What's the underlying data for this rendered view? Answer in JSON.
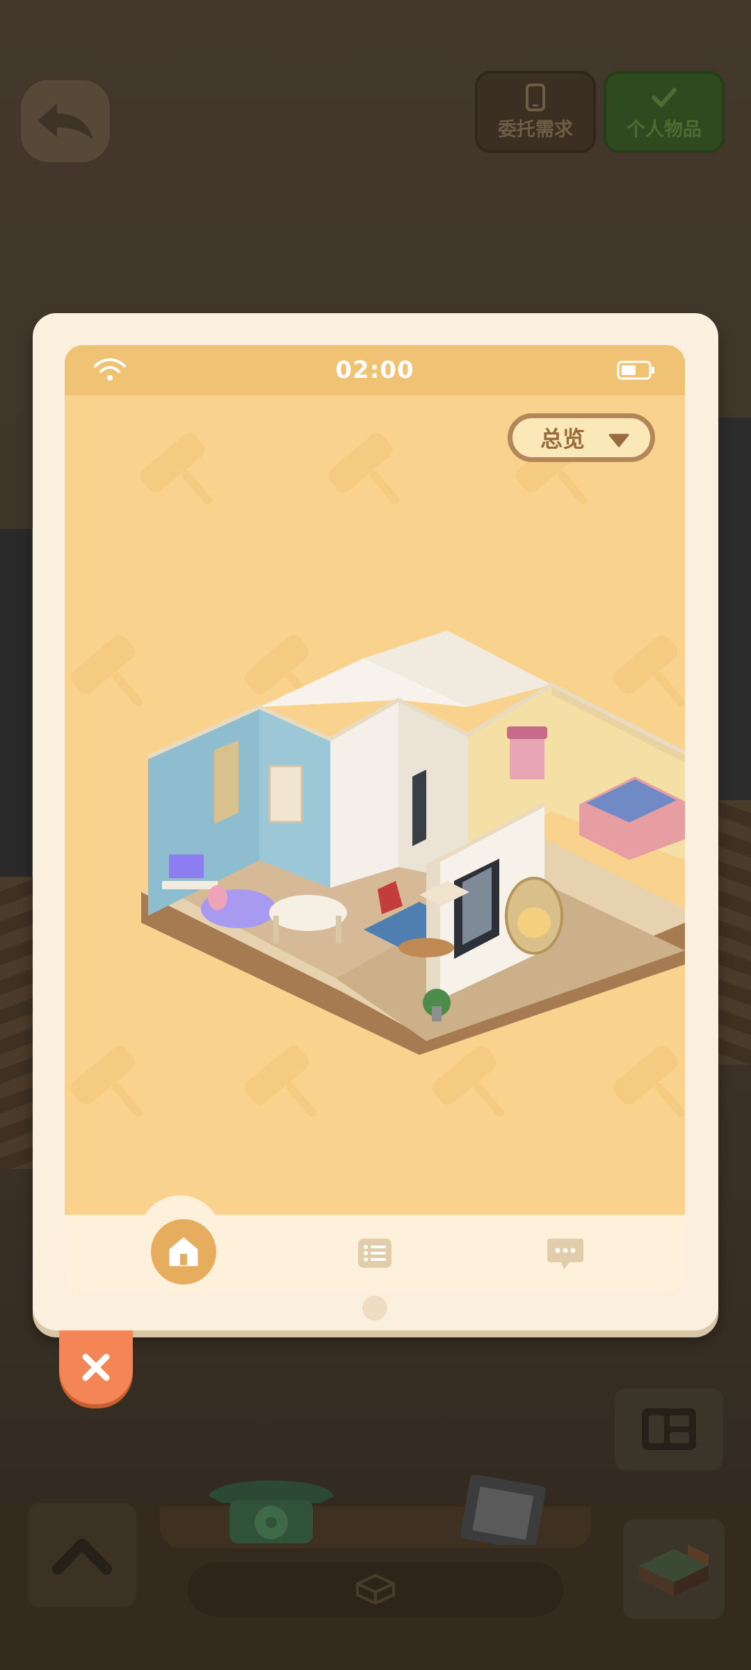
{
  "header": {
    "commission_label": "委托需求",
    "personal_label": "个人物品"
  },
  "phone": {
    "status_time": "02:00",
    "view_dropdown": "总览"
  },
  "colors": {
    "screen_bg": "#f9d38e",
    "status_bar": "#f0c274",
    "frame": "#fbf0dd",
    "close_button": "#f38556",
    "nav_active": "#e6ad5e"
  },
  "icons": {
    "back": "back-arrow-icon",
    "commission": "phone-icon",
    "personal": "check-icon",
    "wifi": "wifi-icon",
    "battery": "battery-icon",
    "dropdown": "caret-down-icon",
    "nav_home": "home-icon",
    "nav_list": "list-icon",
    "nav_chat": "chat-icon",
    "close": "close-icon",
    "up": "chevron-up-icon",
    "layout": "layout-icon"
  }
}
